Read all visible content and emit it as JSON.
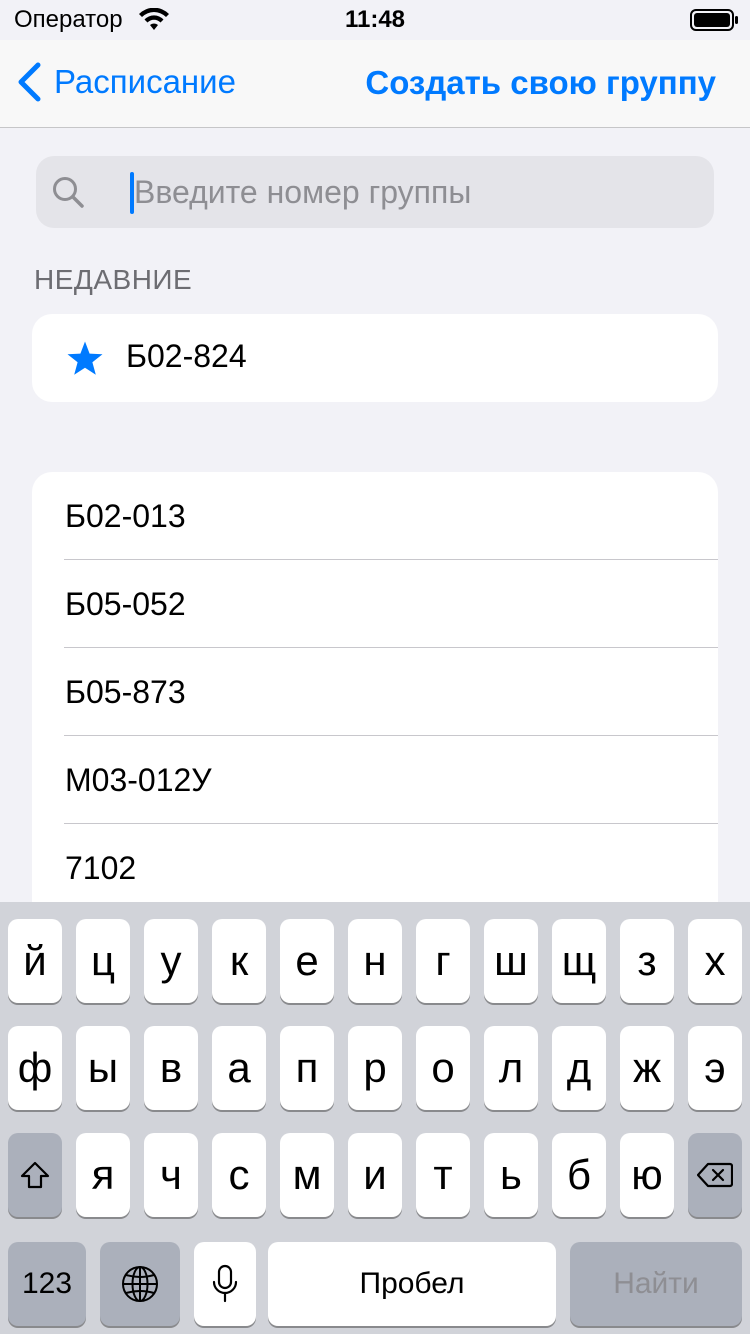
{
  "status_bar": {
    "carrier": "Оператор",
    "time": "11:48"
  },
  "nav": {
    "back_label": "Расписание",
    "action_label": "Создать свою группу"
  },
  "search": {
    "placeholder": "Введите номер группы",
    "value": ""
  },
  "recent": {
    "header": "НЕДАВНИЕ",
    "items": [
      {
        "label": "Б02-824",
        "icon": "star-icon"
      }
    ]
  },
  "groups": [
    {
      "label": "Б02-013"
    },
    {
      "label": "Б05-052"
    },
    {
      "label": "Б05-873"
    },
    {
      "label": "М03-012У"
    },
    {
      "label": "7102"
    }
  ],
  "keyboard": {
    "row1": [
      "й",
      "ц",
      "у",
      "к",
      "е",
      "н",
      "г",
      "ш",
      "щ",
      "з",
      "х"
    ],
    "row2": [
      "ф",
      "ы",
      "в",
      "а",
      "п",
      "р",
      "о",
      "л",
      "д",
      "ж",
      "э"
    ],
    "row3": [
      "я",
      "ч",
      "с",
      "м",
      "и",
      "т",
      "ь",
      "б",
      "ю"
    ],
    "numbers_label": "123",
    "space_label": "Пробел",
    "go_label": "Найти",
    "icons": {
      "shift": "shift-icon",
      "backspace": "backspace-icon",
      "globe": "globe-icon",
      "mic": "microphone-icon"
    }
  },
  "colors": {
    "accent": "#007aff",
    "background": "#f2f2f7",
    "keyboard": "#d1d3d9"
  }
}
